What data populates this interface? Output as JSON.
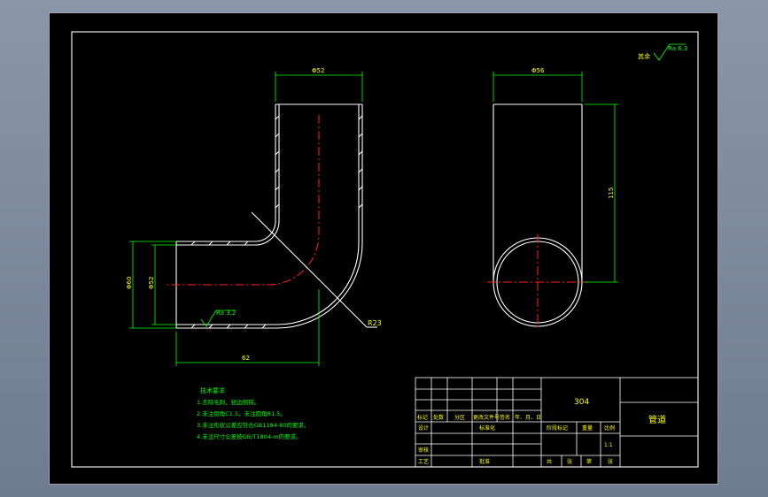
{
  "part_label": "304",
  "drawing_name": "管道",
  "scale": "1:1",
  "roughness": {
    "corner_prefix": "其余",
    "corner_value": "Ra 6.3",
    "pipe_value": "Ra 3.2"
  },
  "dimensions": {
    "elbow_top": "Φ52",
    "elbow_left_outer": "Φ60",
    "elbow_left_inner": "Φ52",
    "elbow_bottom": "62",
    "elbow_radius": "R23",
    "view_top": "Φ56",
    "view_height": "115"
  },
  "notes": {
    "title": "技术要求",
    "items": [
      "1.去除毛刺，锐边倒钝。",
      "2.未注倒角C1.5，未注圆角R1.5。",
      "3.未注形状公差应符合GB1184-80的要求。",
      "4.未注尺寸公差按GB/T1804-m的要求。"
    ]
  },
  "title_block": {
    "header_row": [
      "标记",
      "处数",
      "分区",
      "更改文件号",
      "签名",
      "年、月、日"
    ],
    "design": "设计",
    "standardize": "标准化",
    "review": "审核",
    "process": "工艺",
    "approve": "批准",
    "stage_mark": "阶段标记",
    "weight": "重量",
    "scale_label": "比例",
    "sheets": [
      "共",
      "张",
      "第",
      "张"
    ]
  }
}
